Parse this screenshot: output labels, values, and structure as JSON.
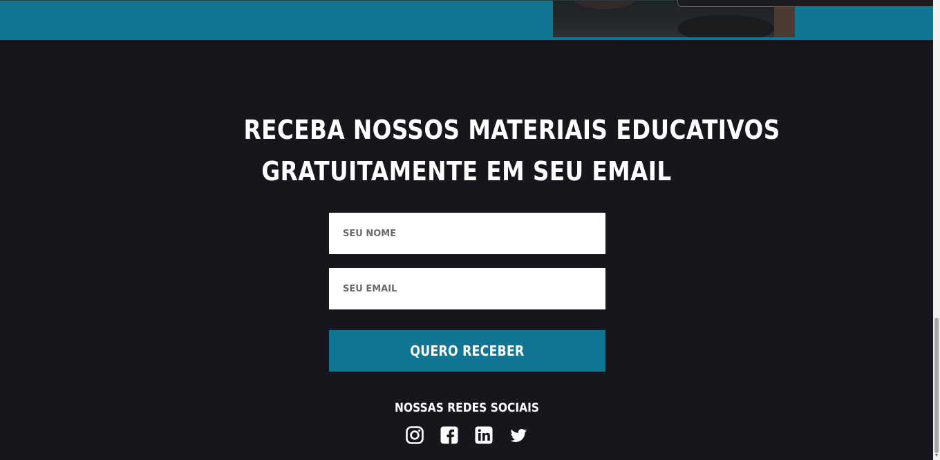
{
  "newsletter": {
    "headline_line1": "RECEBA NOSSOS MATERIAIS EDUCATIVOS",
    "headline_line2": "GRATUITAMENTE EM SEU EMAIL",
    "name_placeholder": "SEU NOME",
    "email_placeholder": "SEU EMAIL",
    "name_value": "",
    "email_value": "",
    "submit_label": "QUERO RECEBER"
  },
  "social": {
    "title": "NOSSAS REDES SOCIAIS",
    "icons": [
      "instagram-icon",
      "facebook-icon",
      "linkedin-icon",
      "twitter-icon"
    ]
  },
  "colors": {
    "accent": "#117693",
    "background": "#17161c",
    "text": "#ffffff"
  }
}
